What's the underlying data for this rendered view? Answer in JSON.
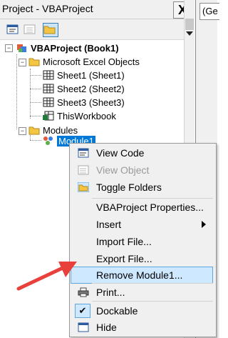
{
  "project_window": {
    "title": "Project - VBAProject",
    "close_label": "X"
  },
  "code_window": {
    "combo_text": "(Ge"
  },
  "tree": {
    "root": "VBAProject (Book1)",
    "excel_objects_folder": "Microsoft Excel Objects",
    "sheets": [
      "Sheet1 (Sheet1)",
      "Sheet2 (Sheet2)",
      "Sheet3 (Sheet3)"
    ],
    "workbook": "ThisWorkbook",
    "modules_folder": "Modules",
    "module": "Module1"
  },
  "context_menu": {
    "view_code": "View Code",
    "view_object": "View Object",
    "toggle_folders": "Toggle Folders",
    "properties": "VBAProject Properties...",
    "insert": "Insert",
    "import_file": "Import File...",
    "export_file": "Export File...",
    "remove_module": "Remove Module1...",
    "print": "Print...",
    "dockable": "Dockable",
    "hide": "Hide"
  },
  "colors": {
    "selection": "#0078d7",
    "highlight": "#cde8ff",
    "arrow": "#e8403a"
  }
}
